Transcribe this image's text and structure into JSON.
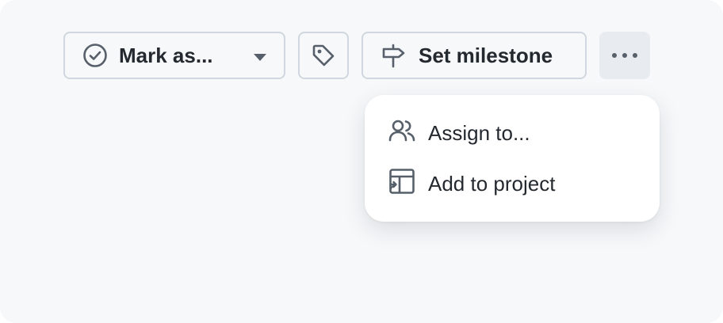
{
  "toolbar": {
    "mark_as_label": "Mark as...",
    "set_milestone_label": "Set milestone",
    "icons": {
      "mark_as": "check-circle-icon",
      "caret": "triangle-down-icon",
      "label": "tag-icon",
      "milestone": "milestone-signpost-icon",
      "more": "kebab-horizontal-icon"
    }
  },
  "overflow_menu": {
    "items": [
      {
        "label": "Assign to...",
        "icon": "people-icon"
      },
      {
        "label": "Add to project",
        "icon": "project-icon"
      }
    ]
  },
  "colors": {
    "background": "#f6f8fa",
    "text": "#24292f",
    "icon": "#57606a",
    "border": "#d0d7de",
    "menu_background": "#ffffff"
  }
}
